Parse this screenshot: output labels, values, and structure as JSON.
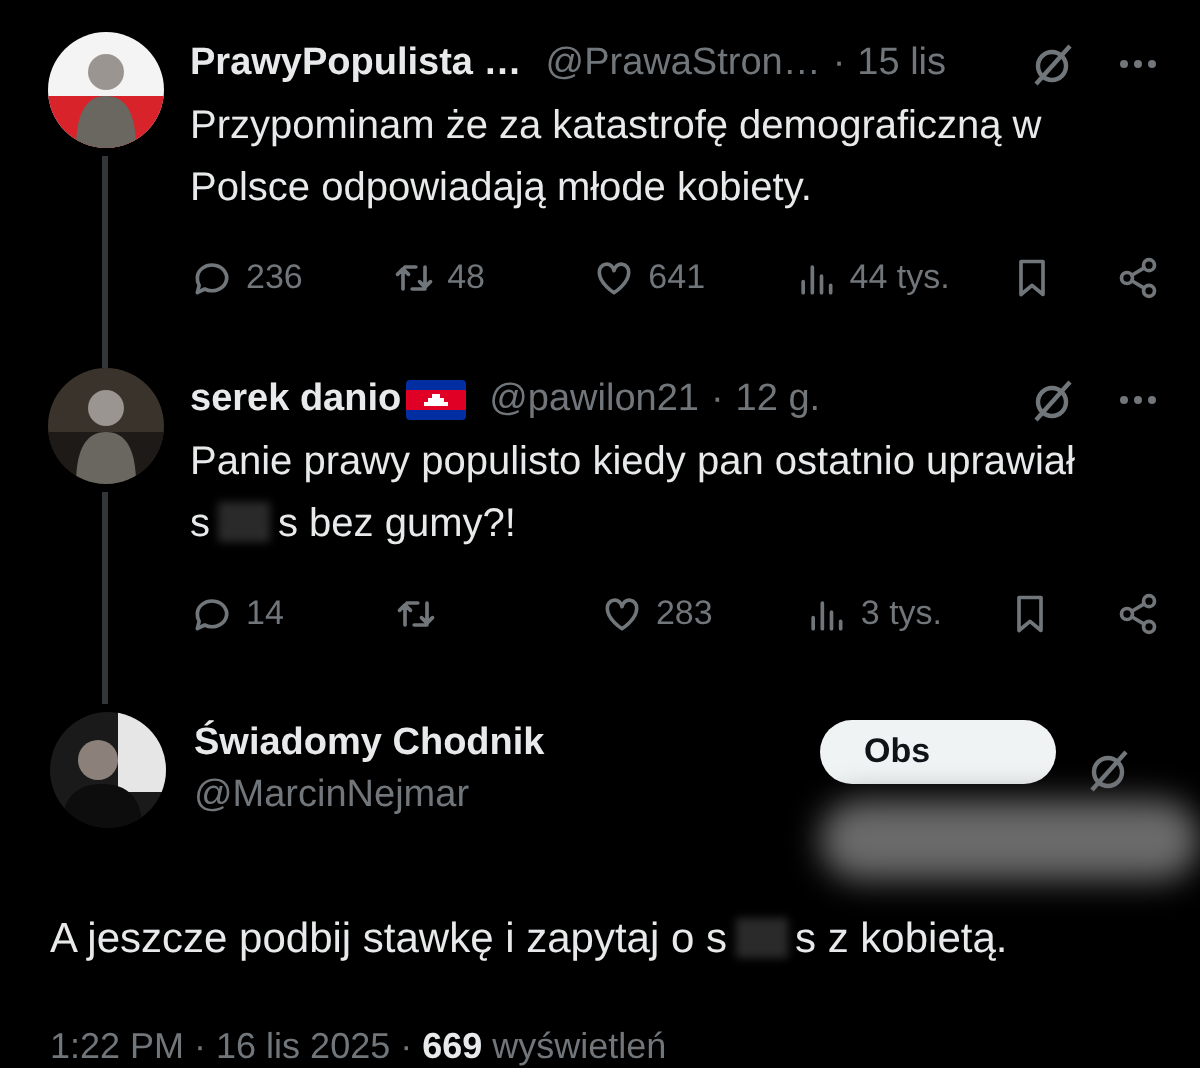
{
  "tweets": [
    {
      "name": "PrawyPopulista …",
      "flag": false,
      "handle": "@PrawaStron…",
      "separator": "·",
      "time": "15 lis",
      "body": [
        {
          "kind": "text",
          "text": "Przypominam że za katastrofę demograficzną w Polsce odpowiadają młode kobiety."
        }
      ],
      "stats": [
        {
          "kind": "reply",
          "count": "236"
        },
        {
          "kind": "repost",
          "count": "48"
        },
        {
          "kind": "like",
          "count": "641"
        },
        {
          "kind": "views",
          "count": "44 tys."
        },
        {
          "kind": "bookmark"
        },
        {
          "kind": "share"
        }
      ]
    },
    {
      "name": "serek danio",
      "flag": true,
      "handle": "@pawilon21",
      "separator": "·",
      "time": "12 g.",
      "body": [
        {
          "kind": "text",
          "text": "Panie prawy populisto kiedy pan ostatnio uprawiał s"
        },
        {
          "kind": "censor"
        },
        {
          "kind": "text",
          "text": "s bez gumy?!"
        }
      ],
      "stats": [
        {
          "kind": "reply",
          "count": "14"
        },
        {
          "kind": "repost"
        },
        {
          "kind": "like",
          "count": "283"
        },
        {
          "kind": "views",
          "count": "3 tys."
        },
        {
          "kind": "bookmark"
        },
        {
          "kind": "share"
        }
      ]
    }
  ],
  "main": {
    "name": "Świadomy Chodnik",
    "handle": "@MarcinNejmar",
    "follow": "Obs",
    "body": [
      {
        "kind": "text",
        "text": "A jeszcze podbij stawkę i zapytaj o s"
      },
      {
        "kind": "censor"
      },
      {
        "kind": "text",
        "text": "s z kobietą."
      }
    ],
    "footer": "1:22 PM · 16 lis 2025 · **669** wyświetleń"
  }
}
